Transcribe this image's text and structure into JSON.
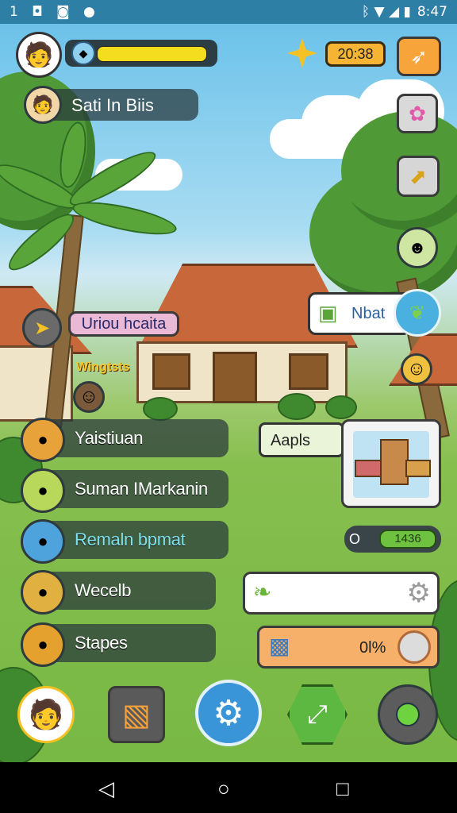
{
  "status_bar": {
    "left_icons": "1 ◘ ◙ ●",
    "right_icons": "ᛒ ▼ ◢ ▮",
    "time": "8:47"
  },
  "hud": {
    "resource_timer": "20:38",
    "player_name": "Sati In Biis",
    "xp_bar_fill": 0.95
  },
  "scene_labels": {
    "location_banner": "Uriou hcaita",
    "npc_tag": "Wingtsts",
    "quest_popup_label": "Nbat",
    "shop_popup_label": "Aapls"
  },
  "menu": [
    {
      "label": "Yaistiuan",
      "icon": "flame-icon",
      "color": "#e8a23a"
    },
    {
      "label": "Suman IMarkanin",
      "icon": "avatar-green-icon",
      "color": "#b7d85a"
    },
    {
      "label": "Remaln bpmat",
      "icon": "avatar-blue-icon",
      "color": "#4fa3dd"
    },
    {
      "label": "Wecelb",
      "icon": "leaf-icon",
      "color": "#e0b040"
    },
    {
      "label": "Stapes",
      "icon": "coin-icon",
      "color": "#e5a12e"
    }
  ],
  "right_panel": {
    "progress_prefix": "O",
    "progress_value": "1436",
    "percent_label": "0l%"
  },
  "bottom_bar": {
    "buttons": [
      "avatar-button",
      "inventory-box-button",
      "settings-gear-button",
      "share-arrow-button",
      "joystick-button"
    ]
  },
  "nav": {
    "back": "◁",
    "home": "○",
    "recents": "□"
  }
}
